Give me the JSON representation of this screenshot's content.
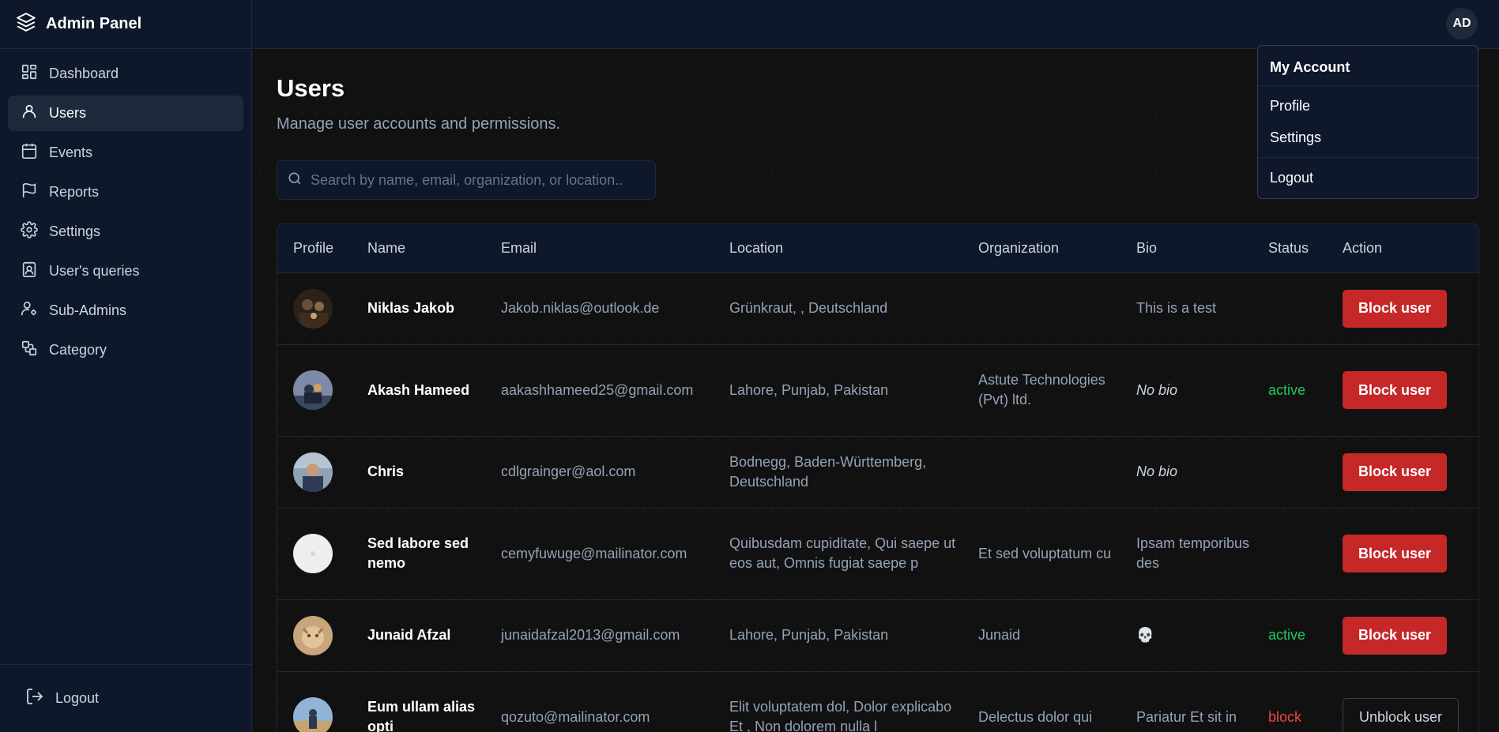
{
  "brand": {
    "title": "Admin Panel"
  },
  "nav": [
    {
      "label": "Dashboard",
      "icon": "dashboard-icon",
      "active": false
    },
    {
      "label": "Users",
      "icon": "user-icon",
      "active": true
    },
    {
      "label": "Events",
      "icon": "calendar-icon",
      "active": false
    },
    {
      "label": "Reports",
      "icon": "flag-icon",
      "active": false
    },
    {
      "label": "Settings",
      "icon": "gear-icon",
      "active": false
    },
    {
      "label": "User's queries",
      "icon": "contact-icon",
      "active": false
    },
    {
      "label": "Sub-Admins",
      "icon": "user-cog-icon",
      "active": false
    },
    {
      "label": "Category",
      "icon": "shapes-icon",
      "active": false
    }
  ],
  "sidebar_footer": {
    "logout_label": "Logout"
  },
  "topbar": {
    "avatar_initials": "AD"
  },
  "page": {
    "title": "Users",
    "subtitle": "Manage user accounts and permissions.",
    "search_placeholder": "Search by name, email, organization, or location.."
  },
  "table": {
    "headers": [
      "Profile",
      "Name",
      "Email",
      "Location",
      "Organization",
      "Bio",
      "Status",
      "Action"
    ],
    "rows": [
      {
        "name": "Niklas Jakob",
        "email": "Jakob.niklas@outlook.de",
        "location": "Grünkraut, , Deutschland",
        "organization": "",
        "bio": "This is a test",
        "status": "",
        "action": "Block user"
      },
      {
        "name": "Akash Hameed",
        "email": "aakashhameed25@gmail.com",
        "location": "Lahore, Punjab, Pakistan",
        "organization": "Astute Technologies (Pvt) ltd.",
        "bio": "No bio",
        "status": "active",
        "action": "Block user"
      },
      {
        "name": "Chris",
        "email": "cdlgrainger@aol.com",
        "location": "Bodnegg, Baden-Württemberg, Deutschland",
        "organization": "",
        "bio": "No bio",
        "status": "",
        "action": "Block user"
      },
      {
        "name": "Sed labore sed nemo",
        "email": "cemyfuwuge@mailinator.com",
        "location": "Quibusdam cupiditate, Qui saepe ut eos aut, Omnis fugiat saepe p",
        "organization": "Et sed voluptatum cu",
        "bio": "Ipsam temporibus des",
        "status": "",
        "action": "Block user"
      },
      {
        "name": "Junaid Afzal",
        "email": "junaidafzal2013@gmail.com",
        "location": "Lahore, Punjab, Pakistan",
        "organization": "Junaid",
        "bio": "💀",
        "status": "active",
        "action": "Block user"
      },
      {
        "name": "Eum ullam alias opti",
        "email": "qozuto@mailinator.com",
        "location": "Elit voluptatem dol, Dolor explicabo Et , Non dolorem nulla l",
        "organization": "Delectus dolor qui",
        "bio": "Pariatur Et sit in",
        "status": "block",
        "action": "Unblock user"
      }
    ]
  },
  "dropdown": {
    "header": "My Account",
    "items": [
      "Profile",
      "Settings"
    ],
    "logout": "Logout"
  },
  "colors": {
    "sidebar_bg": "#0f172a",
    "main_bg": "#111111",
    "accent_red": "#c62828",
    "status_active": "#22c55e",
    "status_block": "#ef4444"
  }
}
